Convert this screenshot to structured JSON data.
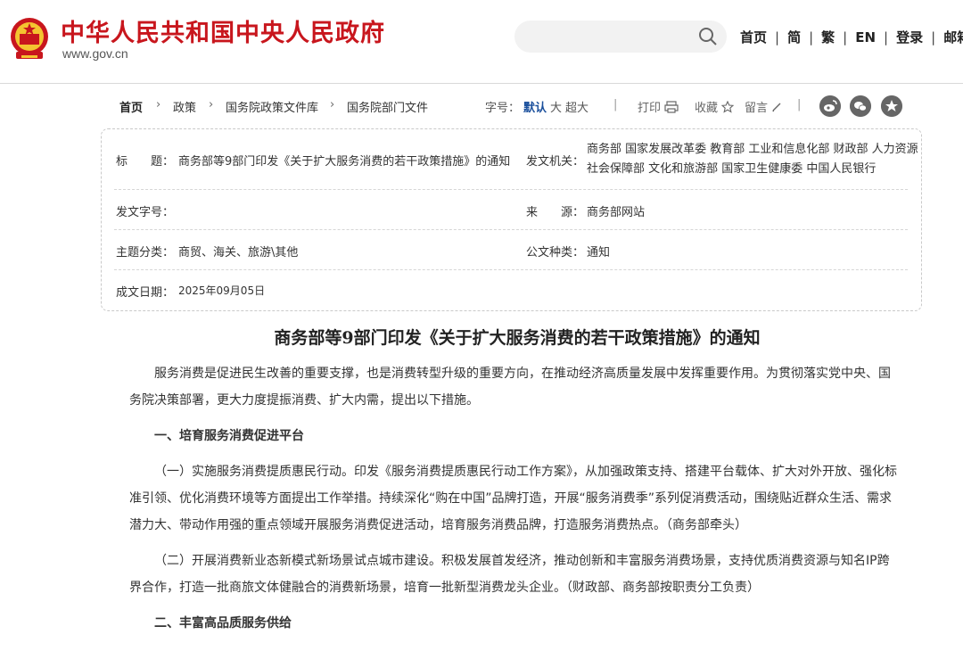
{
  "header": {
    "site_title": "中华人民共和国中央人民政府",
    "site_url": "www.gov.cn",
    "search_placeholder": "",
    "nav": [
      "首页",
      "简",
      "繁",
      "EN",
      "登录",
      "邮箱"
    ],
    "nav_sep": "|",
    "emblem_color": "#c8161d"
  },
  "breadcrumb": {
    "items": [
      "首页",
      "政策",
      "国务院政策文件库",
      "国务院部门文件"
    ],
    "arrow": "›"
  },
  "toolbar": {
    "font_size_label": "字号：",
    "font_sizes": [
      "默认",
      "大",
      "超大"
    ],
    "sep": "|",
    "print_label": "打印",
    "favorite_label": "收藏",
    "comment_label": "留言",
    "share_icons": [
      "weibo-icon",
      "wechat-icon",
      "favorite-star-icon"
    ]
  },
  "meta": {
    "title_label": "标　　题：",
    "title_value": "商务部等9部门印发《关于扩大服务消费的若干政策措施》的通知",
    "org_label": "发文机关：",
    "org_value": "商务部  国家发展改革委  教育部  工业和信息化部  财政部  人力资源社会保障部  文化和旅游部  国家卫生健康委  中国人民银行",
    "docno_label": "发文字号：",
    "docno_value": "",
    "source_label": "来　　源：",
    "source_value": "商务部网站",
    "topic_label": "主题分类：",
    "topic_value": "商贸、海关、旅游\\其他",
    "doctype_label": "公文种类：",
    "doctype_value": "通知",
    "date_label": "成文日期：",
    "date_value": "2025年09月05日"
  },
  "article": {
    "title": "商务部等9部门印发《关于扩大服务消费的若干政策措施》的通知",
    "p1": "服务消费是促进民生改善的重要支撑，也是消费转型升级的重要方向，在推动经济高质量发展中发挥重要作用。为贯彻落实党中央、国务院决策部署，更大力度提振消费、扩大内需，提出以下措施。",
    "h1": "一、培育服务消费促进平台",
    "p2": "（一）实施服务消费提质惠民行动。印发《服务消费提质惠民行动工作方案》，从加强政策支持、搭建平台载体、扩大对外开放、强化标准引领、优化消费环境等方面提出工作举措。持续深化“购在中国”品牌打造，开展“服务消费季”系列促消费活动，围绕贴近群众生活、需求潜力大、带动作用强的重点领域开展服务消费促进活动，培育服务消费品牌，打造服务消费热点。（商务部牵头）",
    "p3": "（二）开展消费新业态新模式新场景试点城市建设。积极发展首发经济，推动创新和丰富服务消费场景，支持优质消费资源与知名IP跨界合作，打造一批商旅文体健融合的消费新场景，培育一批新型消费龙头企业。（财政部、商务部按职责分工负责）",
    "h2": "二、丰富高品质服务供给"
  }
}
